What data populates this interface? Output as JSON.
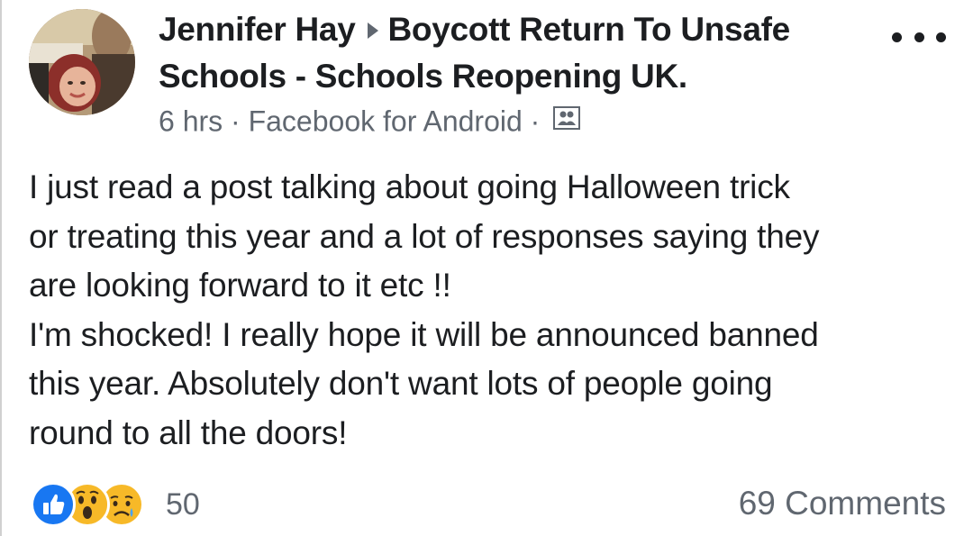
{
  "post": {
    "author": "Jennifer Hay",
    "group_line1": "Boycott Return To Unsafe",
    "group_line2": "Schools - Schools Reopening UK.",
    "time": "6 hrs",
    "separator": "·",
    "source": "Facebook for Android",
    "audience_icon": "group-icon",
    "body_lines": [
      "I just read a post talking about going Halloween trick",
      "or treating this year and a lot of responses saying they",
      "are looking forward to it etc !!",
      "I'm shocked! I really hope it will be announced banned",
      "this year. Absolutely don't want lots of people going",
      "round to all the doors!"
    ]
  },
  "reactions": {
    "types": [
      "like-icon",
      "wow-icon",
      "sad-icon"
    ],
    "count": "50"
  },
  "comments_label": "69 Comments",
  "colors": {
    "text": "#1c1e21",
    "secondary": "#606770",
    "like_blue": "#1877f2",
    "emoji_yellow": "#f7b928"
  }
}
